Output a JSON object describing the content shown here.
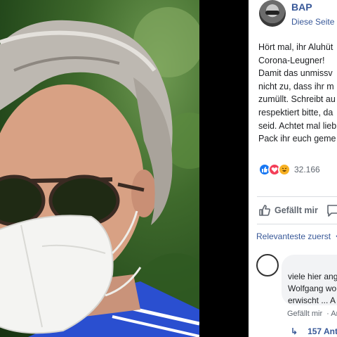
{
  "page": {
    "name": "BAP",
    "subtitle": "Diese Seite g"
  },
  "post": {
    "lines": [
      "Hört mal, ihr Aluhüt",
      "Corona-Leugner!",
      "Damit das unmissv",
      "nicht zu, dass ihr m",
      "zumüllt. Schreibt au",
      "respektiert bitte, da",
      "seid. Achtet mal lieb",
      "Pack ihr euch geme"
    ],
    "reaction_count": "32.166"
  },
  "actions": {
    "like_label": "Gefällt mir"
  },
  "comments": {
    "sort_label": "Relevanteste zuerst",
    "sort_icon": "chevron-down-icon",
    "items": [
      {
        "lines": [
          "viele hier ang",
          "Wolfgang wo",
          "erwischt ... A"
        ],
        "like_label": "Gefällt mir",
        "reply_label": "An",
        "replies_label": "157 Ant"
      }
    ]
  },
  "colors": {
    "link": "#385898",
    "like_reaction": "#1877f2",
    "love_reaction": "#f33e58",
    "haha_reaction": "#f7b125"
  }
}
